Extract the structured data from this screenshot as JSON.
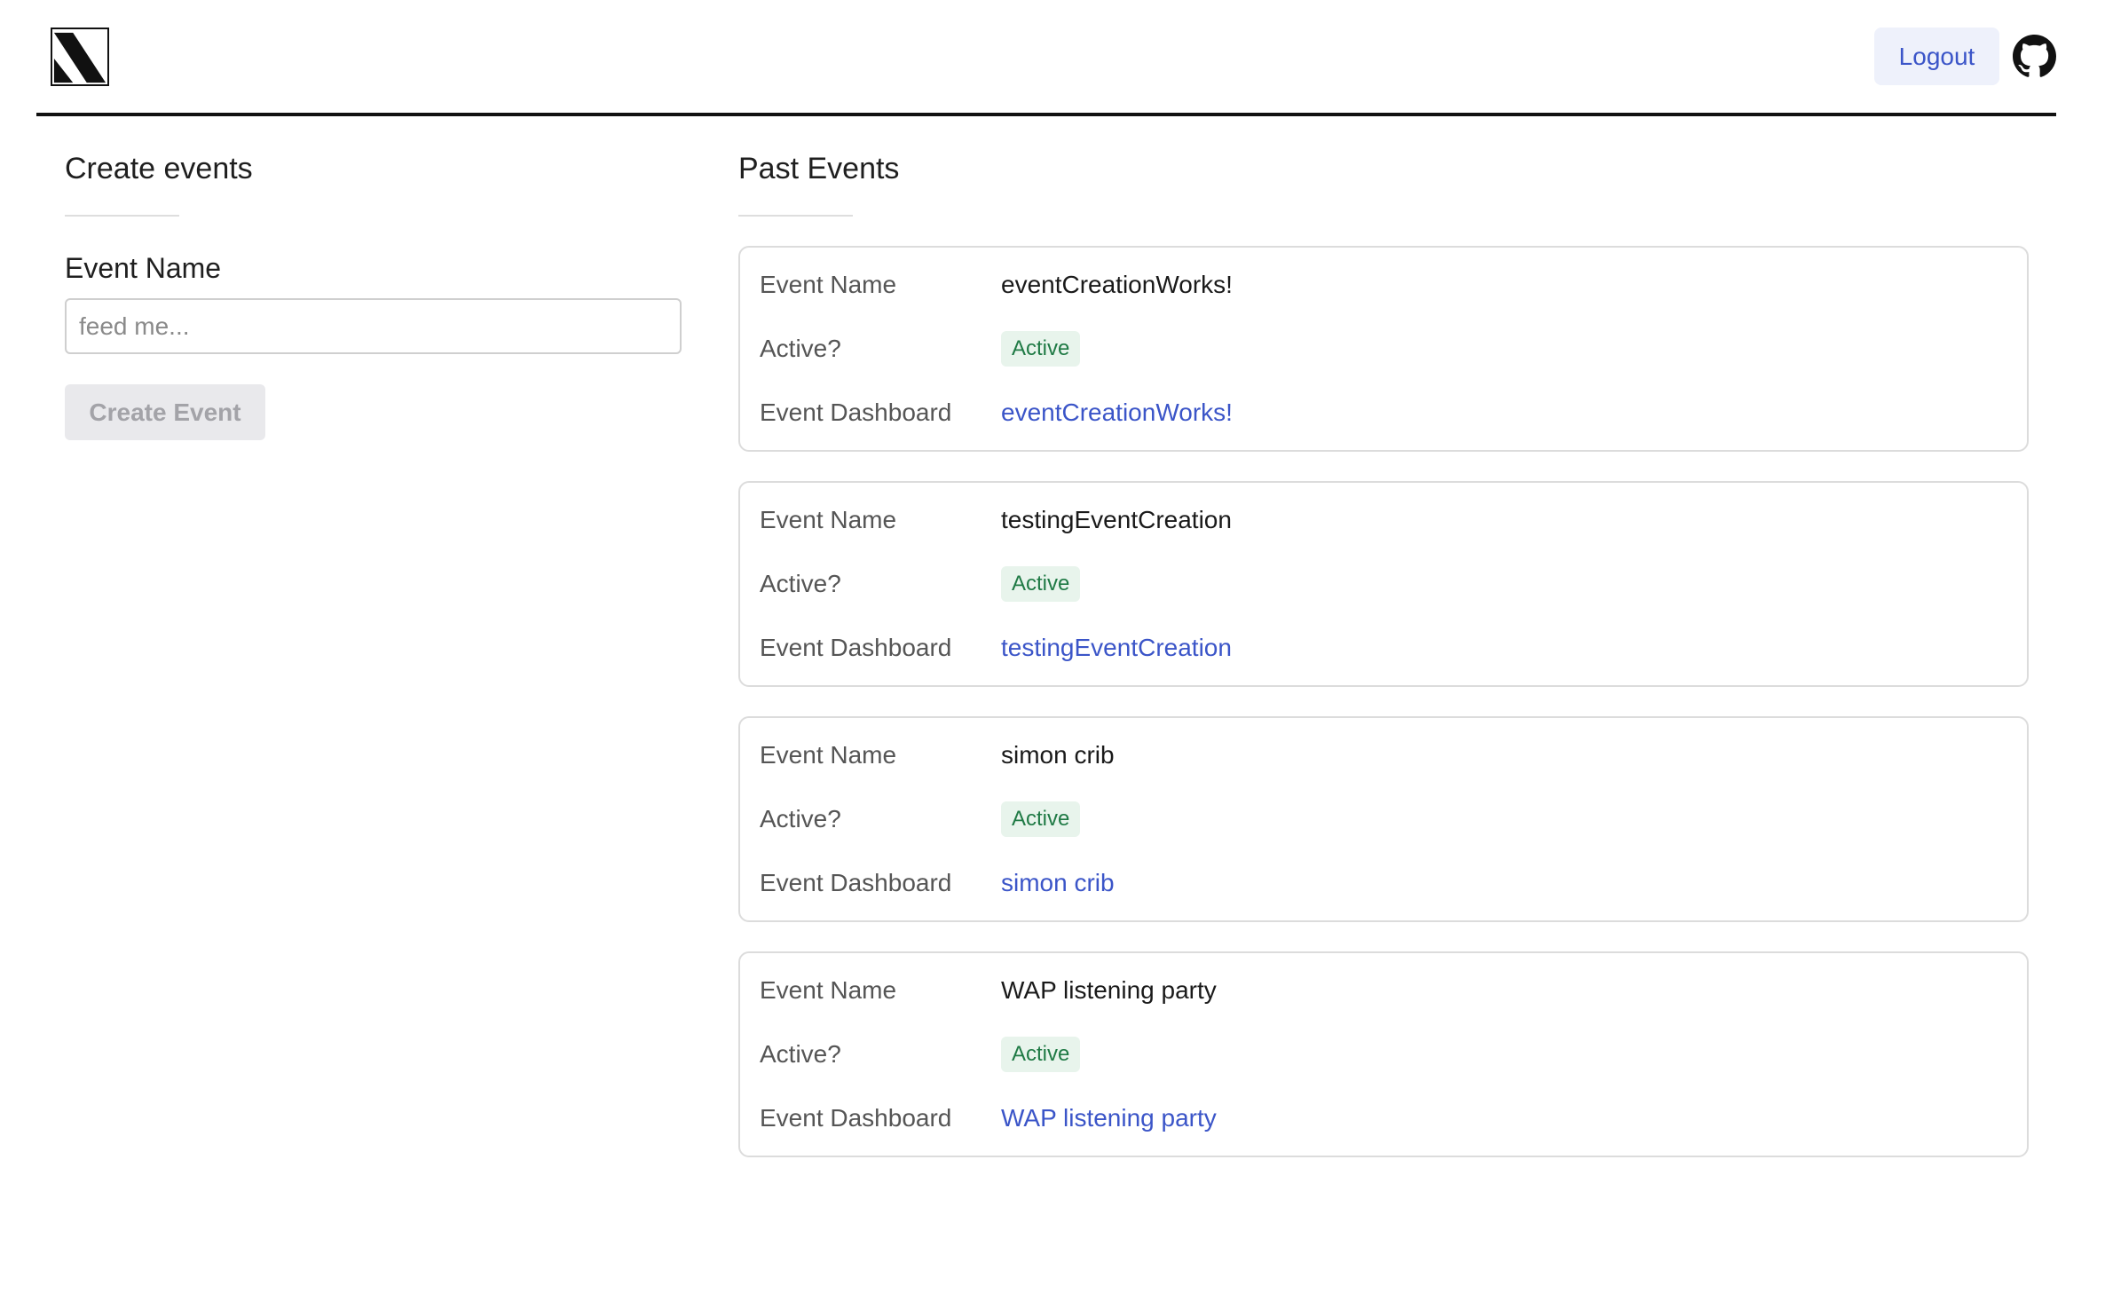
{
  "header": {
    "logout_label": "Logout",
    "github_icon": "github-icon",
    "logo_icon": "logo-icon"
  },
  "create": {
    "title": "Create events",
    "field_label": "Event Name",
    "placeholder": "feed me...",
    "value": "",
    "button_label": "Create Event"
  },
  "past": {
    "title": "Past Events",
    "labels": {
      "name": "Event Name",
      "active": "Active?",
      "dashboard": "Event Dashboard"
    },
    "events": [
      {
        "name": "eventCreationWorks!",
        "status": "Active",
        "dashboard": "eventCreationWorks!"
      },
      {
        "name": "testingEventCreation",
        "status": "Active",
        "dashboard": "testingEventCreation"
      },
      {
        "name": "simon crib",
        "status": "Active",
        "dashboard": "simon crib"
      },
      {
        "name": "WAP listening party",
        "status": "Active",
        "dashboard": "WAP listening party"
      }
    ]
  },
  "colors": {
    "accent": "#3b55c8",
    "badge_bg": "#e8f4ec",
    "badge_text": "#1f7a45"
  }
}
